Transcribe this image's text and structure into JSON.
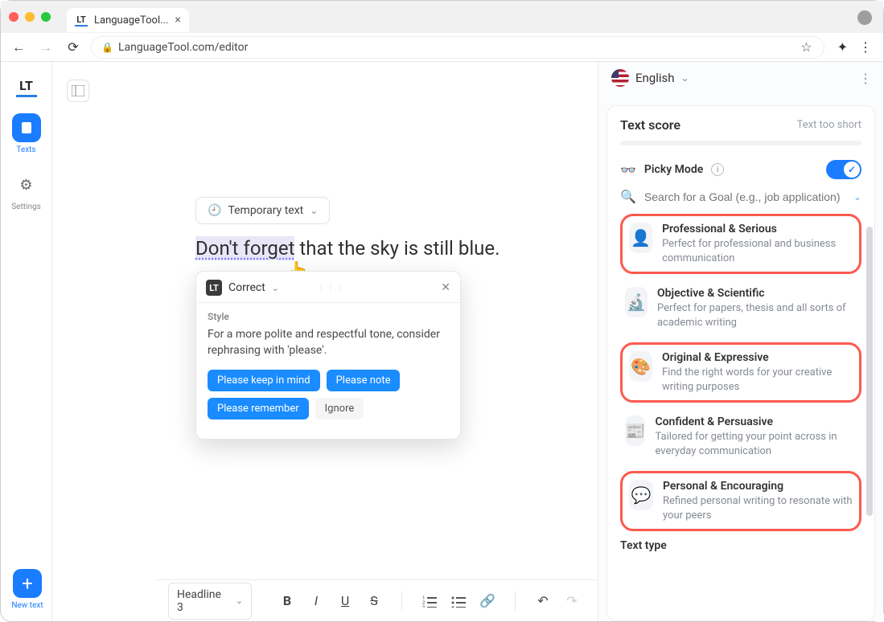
{
  "browser": {
    "tab_title": "LanguageTool...",
    "url": "LanguageTool.com/editor"
  },
  "sidebar": {
    "texts_label": "Texts",
    "settings_label": "Settings",
    "new_text_label": "New text"
  },
  "editor": {
    "doc_chip": "Temporary text",
    "sentence_highlight": "Don't forget",
    "sentence_rest": " that the sky is still blue."
  },
  "popup": {
    "title": "Correct",
    "section": "Style",
    "description": "For a more polite and respectful tone, consider rephrasing with 'please'.",
    "suggestions": [
      "Please keep in mind",
      "Please note",
      "Please remember"
    ],
    "ignore": "Ignore"
  },
  "toolbar": {
    "style_select": "Headline 3"
  },
  "right_panel": {
    "language": "English",
    "score_title": "Text score",
    "score_sub": "Text too short",
    "picky_label": "Picky Mode",
    "search_placeholder": "Search for a Goal (e.g., job application)",
    "text_type_label": "Text type",
    "goals": [
      {
        "icon": "👤",
        "title": "Professional & Serious",
        "desc": "Perfect for professional and business communication",
        "highlighted": true
      },
      {
        "icon": "🔬",
        "title": "Objective & Scientific",
        "desc": "Perfect for papers, thesis and all sorts of academic writing",
        "highlighted": false
      },
      {
        "icon": "🎨",
        "title": "Original & Expressive",
        "desc": "Find the right words for your creative writing purposes",
        "highlighted": true
      },
      {
        "icon": "📰",
        "title": "Confident & Persuasive",
        "desc": "Tailored for getting your point across in everyday communication",
        "highlighted": false
      },
      {
        "icon": "💬",
        "title": "Personal & Encouraging",
        "desc": "Refined personal writing to resonate with your peers",
        "highlighted": true
      }
    ]
  }
}
